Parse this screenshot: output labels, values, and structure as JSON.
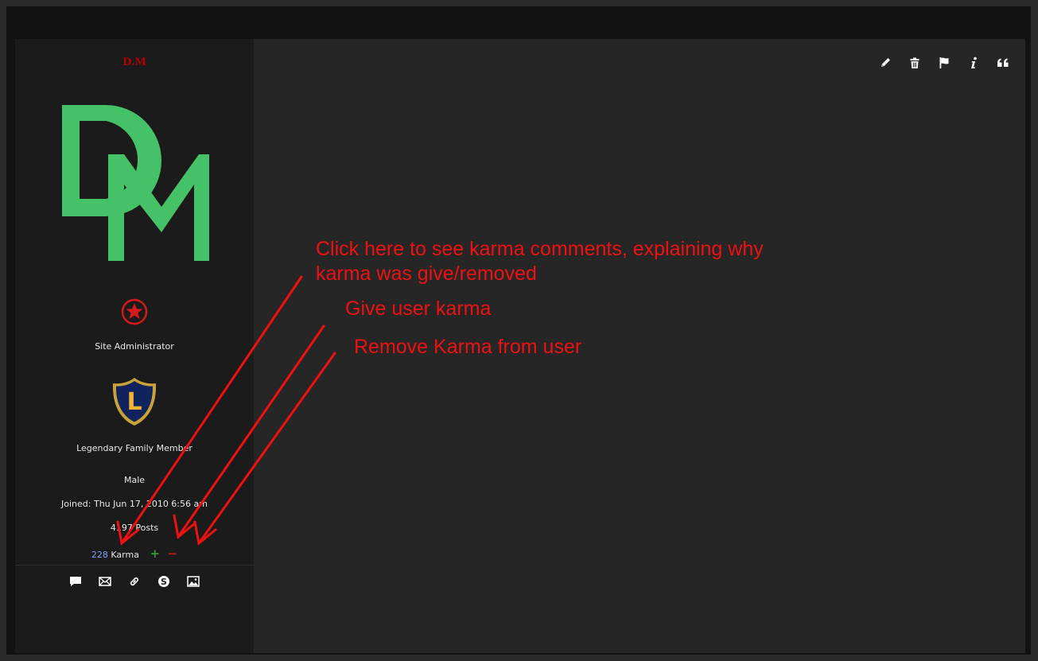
{
  "profile": {
    "username": "D.M",
    "rank_title": "Site Administrator",
    "group_title": "Legendary Family Member",
    "group_badge_letter": "L",
    "gender": "Male",
    "joined": "Joined: Thu Jun 17, 2010 6:56 am",
    "posts": "4197 Posts",
    "karma_count": "228",
    "karma_label": "Karma",
    "karma_plus": "+",
    "karma_minus": "−"
  },
  "contact_icons": [
    "message-icon",
    "email-icon",
    "link-icon",
    "skype-icon",
    "image-icon"
  ],
  "post_actions": [
    "edit-icon",
    "delete-icon",
    "report-icon",
    "info-icon",
    "quote-icon"
  ],
  "annotations": {
    "karma_comments_line1": "Click here to see karma comments, explaining why",
    "karma_comments_line2": "karma was give/removed",
    "give_karma": "Give user karma",
    "remove_karma": "Remove Karma from user"
  },
  "colors": {
    "username": "#b30000",
    "logo_green": "#45c168",
    "annotation_red": "#ee1111",
    "karma_count": "#7fa3ff",
    "karma_plus": "#2e9a2e",
    "karma_minus": "#c11c1c"
  }
}
